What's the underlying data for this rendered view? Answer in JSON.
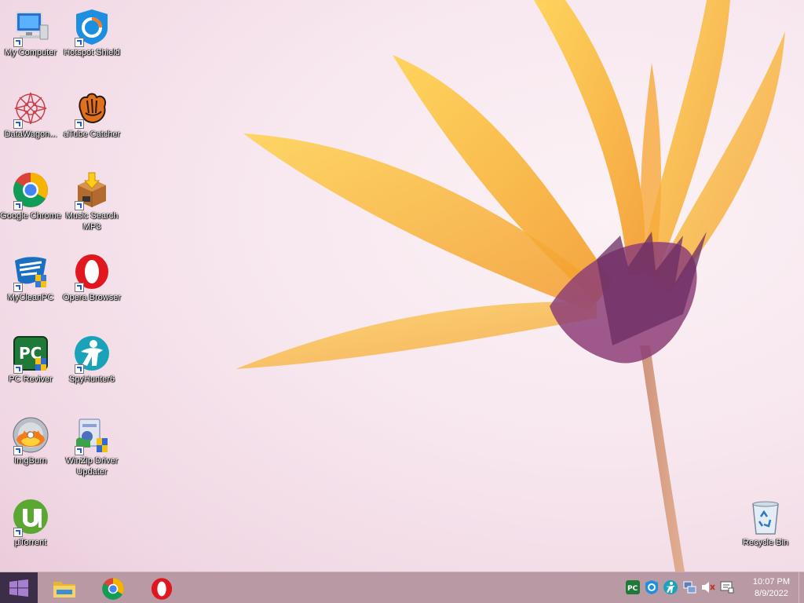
{
  "desktop": {
    "icons": [
      {
        "label": "My Computer",
        "icon": "computer-icon"
      },
      {
        "label": "Hotspot Shield",
        "icon": "hotspot-shield-icon"
      },
      {
        "label": "DataWagon...",
        "icon": "datawagon-icon"
      },
      {
        "label": "aTube Catcher",
        "icon": "atube-catcher-icon"
      },
      {
        "label": "Google Chrome",
        "icon": "chrome-icon"
      },
      {
        "label": "Music Search MP3",
        "icon": "music-search-icon"
      },
      {
        "label": "MyCleanPC",
        "icon": "mycleanpc-icon"
      },
      {
        "label": "Opera Browser",
        "icon": "opera-icon"
      },
      {
        "label": "PC Reviver",
        "icon": "pc-reviver-icon"
      },
      {
        "label": "SpyHunter6",
        "icon": "spyhunter-icon"
      },
      {
        "label": "ImgBurn",
        "icon": "imgburn-icon"
      },
      {
        "label": "WinZip Driver Updater",
        "icon": "winzip-driver-updater-icon"
      },
      {
        "label": "µTorrent",
        "icon": "utorrent-icon"
      },
      {
        "label": "Recycle Bin",
        "icon": "recycle-bin-icon"
      }
    ]
  },
  "taskbar": {
    "pinned": [
      {
        "name": "File Explorer",
        "icon": "file-explorer-icon"
      },
      {
        "name": "Google Chrome",
        "icon": "chrome-icon"
      },
      {
        "name": "Opera",
        "icon": "opera-icon"
      }
    ],
    "tray": [
      "pc-reviver-tray-icon",
      "hotspot-shield-tray-icon",
      "spyhunter-tray-icon",
      "network-tray-icon",
      "volume-muted-icon",
      "action-center-icon"
    ],
    "clock": {
      "time": "10:07 PM",
      "date": "8/9/2022"
    }
  },
  "colors": {
    "taskbar": "#b99aa4",
    "start": "#3c2e48",
    "petal": "#f6b43a"
  }
}
